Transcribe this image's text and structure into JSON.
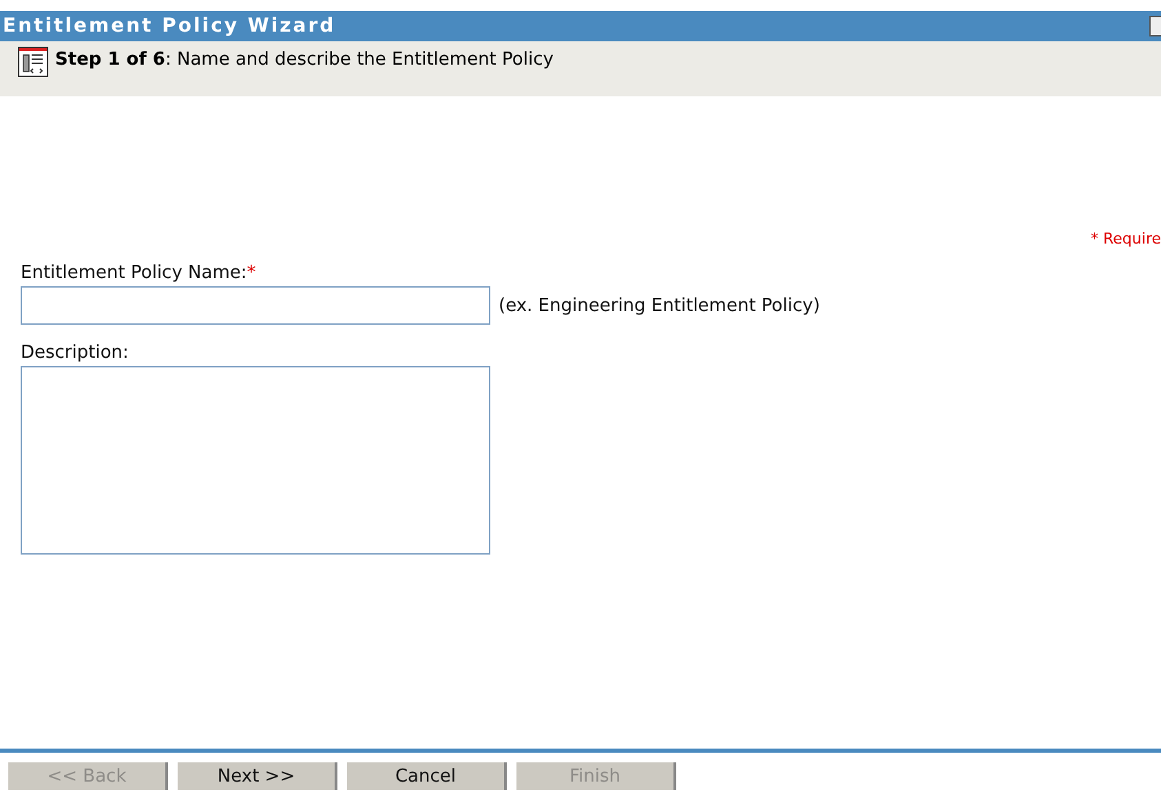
{
  "window": {
    "title": "Entitlement Policy Wizard"
  },
  "step": {
    "text": "**Step 1 of 6**: Name and describe the Entitlement Policy"
  },
  "required_note": "* Require",
  "fields": [
    {
      "kind": "input",
      "label": "Entitlement Policy Name:",
      "required_mark": "*",
      "hint": "(ex. Engineering Entitlement Policy)"
    },
    {
      "kind": "textarea",
      "label": "Description:"
    }
  ],
  "buttons": [
    {
      "label": "<< Back",
      "disabled": true
    },
    {
      "label": "Next >>",
      "disabled": false
    },
    {
      "label": "Cancel",
      "disabled": false
    },
    {
      "label": "Finish",
      "disabled": true
    }
  ]
}
